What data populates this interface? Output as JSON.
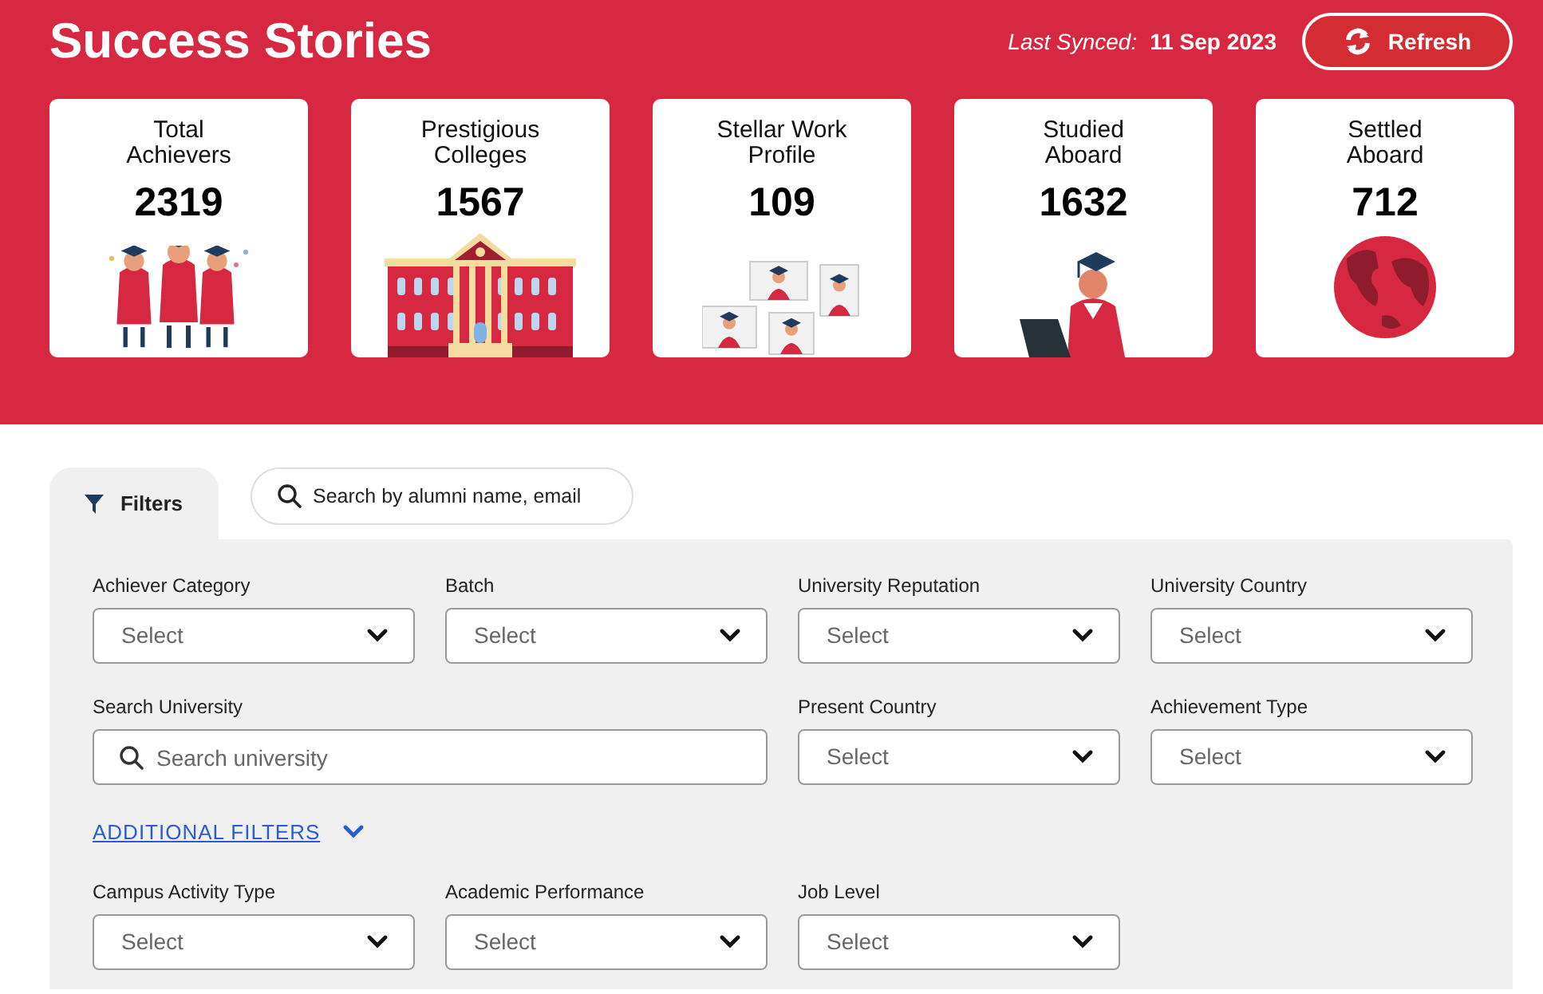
{
  "header": {
    "title": "Success Stories",
    "last_synced_label": "Last Synced:",
    "last_synced_value": "11 Sep 2023",
    "refresh_button": "Refresh"
  },
  "stats": [
    {
      "label": "Total Achievers",
      "value": "2319",
      "kind": "graduates"
    },
    {
      "label": "Prestigious Colleges",
      "value": "1567",
      "kind": "building"
    },
    {
      "label": "Stellar Work Profile",
      "value": "109",
      "kind": "profiles"
    },
    {
      "label": "Studied Aboard",
      "value": "1632",
      "kind": "student"
    },
    {
      "label": "Settled Aboard",
      "value": "712",
      "kind": "globe"
    }
  ],
  "filters_tab": {
    "label": "Filters"
  },
  "search": {
    "placeholder": "Search by alumni name, email"
  },
  "filter_rows": [
    [
      {
        "label": "Achiever Category",
        "kind": "select",
        "placeholder": "Select"
      },
      {
        "label": "Batch",
        "kind": "select",
        "placeholder": "Select"
      },
      {
        "label": "University Reputation",
        "kind": "select",
        "placeholder": "Select"
      },
      {
        "label": "University Country",
        "kind": "select",
        "placeholder": "Select"
      }
    ],
    [
      {
        "label": "Search University",
        "kind": "search",
        "placeholder": "Search university"
      },
      {
        "label": "Present Country",
        "kind": "select",
        "placeholder": "Select"
      },
      {
        "label": "Achievement Type",
        "kind": "select",
        "placeholder": "Select"
      }
    ]
  ],
  "additional_filters": {
    "label": "ADDITIONAL FILTERS"
  },
  "additional_rows": [
    [
      {
        "label": "Campus Activity Type",
        "kind": "select",
        "placeholder": "Select"
      },
      {
        "label": "Academic Performance",
        "kind": "select",
        "placeholder": "Select"
      },
      {
        "label": "Job Level",
        "kind": "select",
        "placeholder": "Select"
      }
    ]
  ]
}
